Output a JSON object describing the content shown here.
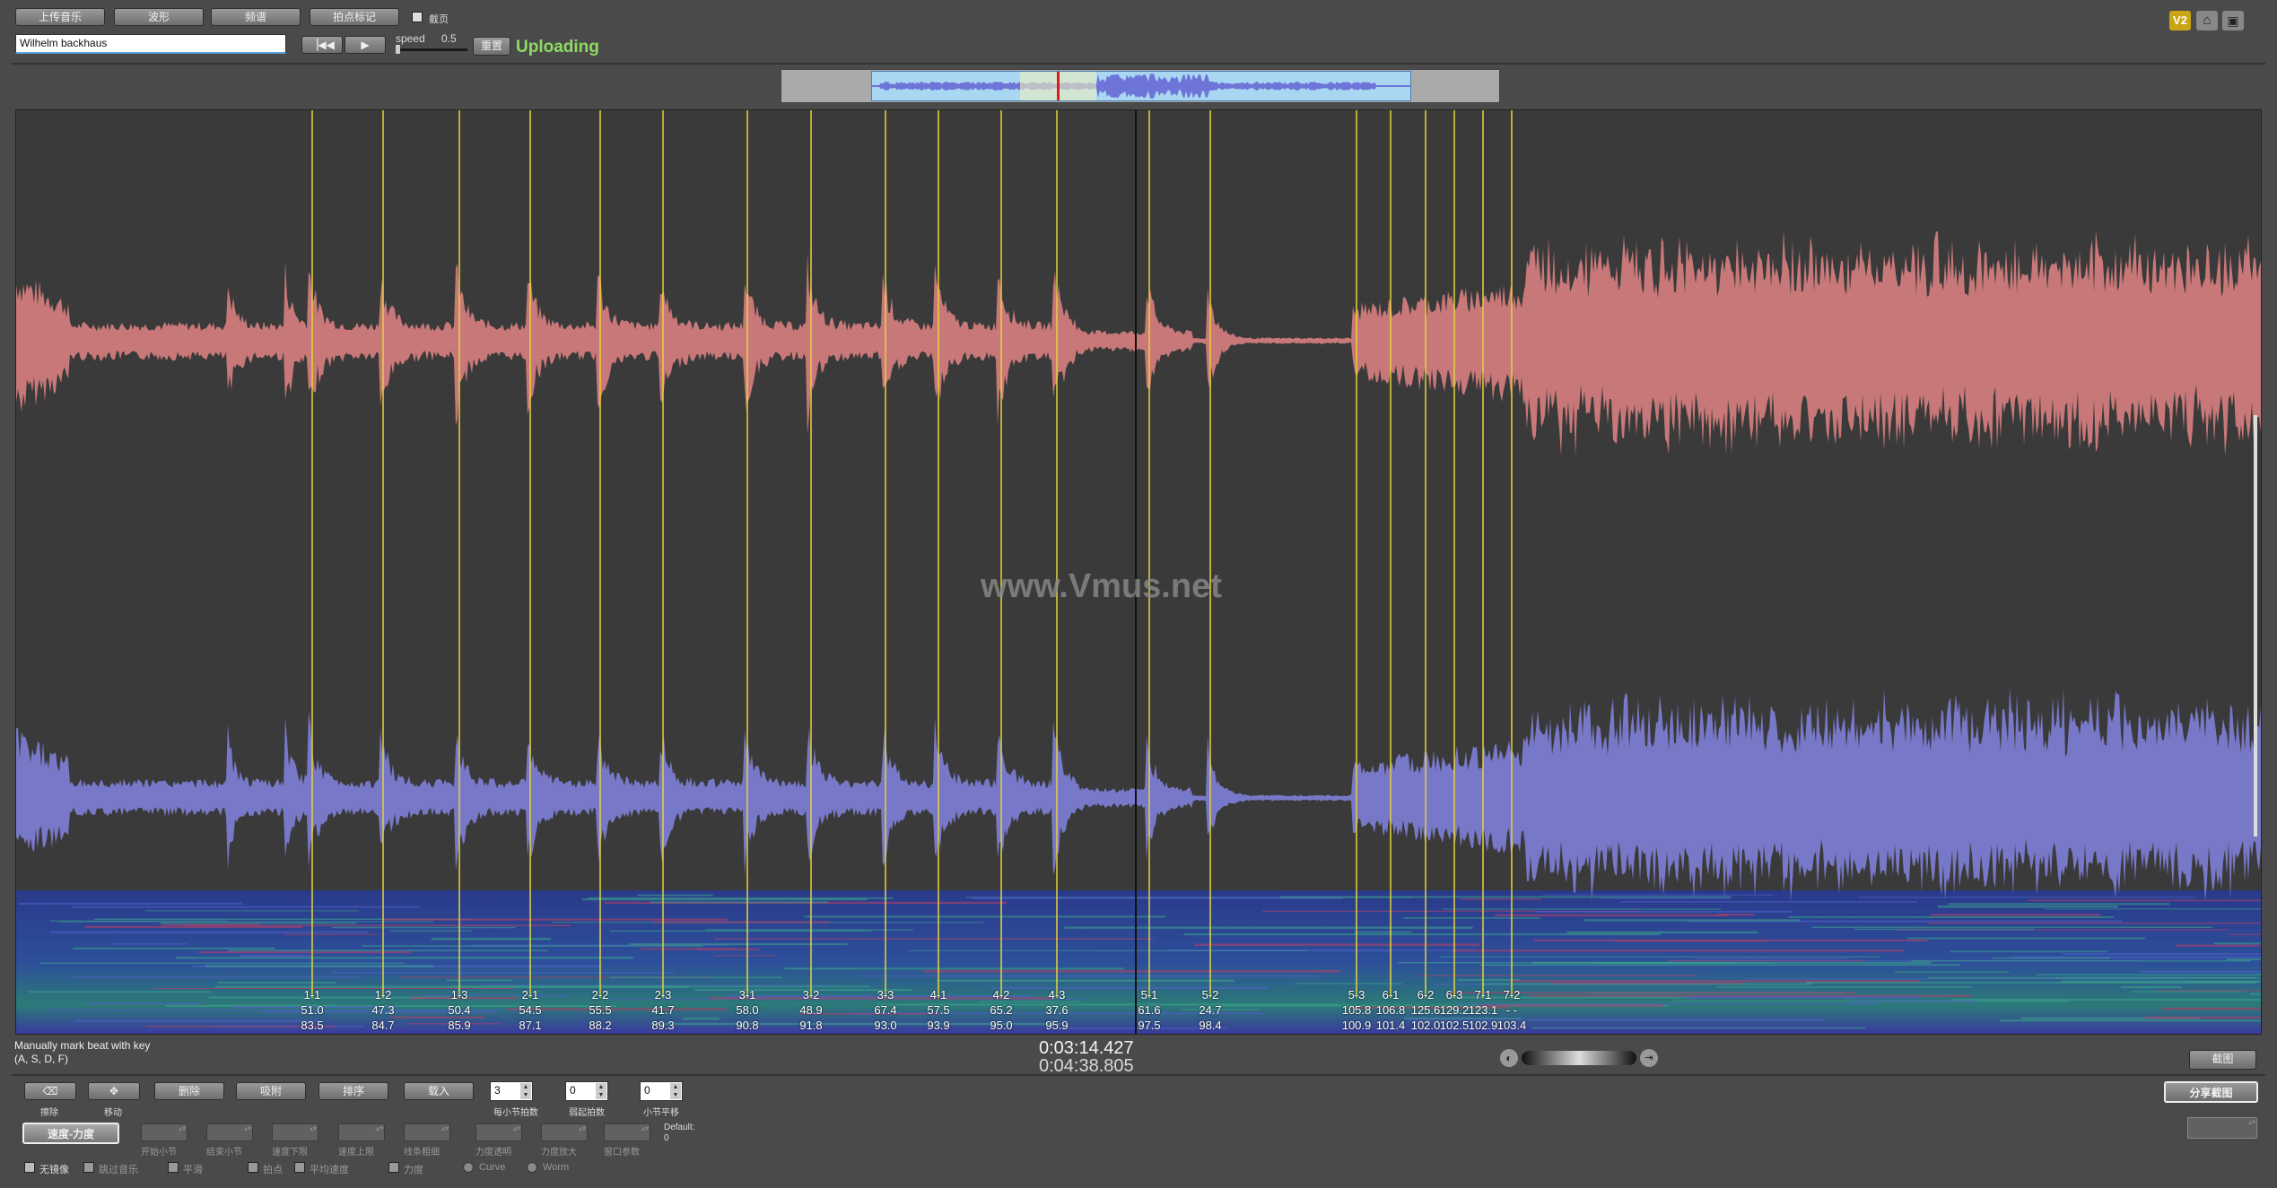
{
  "toolbar": {
    "buttons": [
      "上传音乐",
      "波形",
      "频谱",
      "拍点标记"
    ],
    "checkbox_label": "截页",
    "artist_input": "Wilhelm backhaus",
    "speed_label": "speed",
    "speed_value": "0.5",
    "reset_label": "重置",
    "status": "Uploading",
    "version_badge": "V2"
  },
  "overview": {
    "label": "overview-waveform"
  },
  "watermark": "www.Vmus.net",
  "beats": [
    {
      "label": "1-1",
      "tempo": "51.0",
      "time": "83.5"
    },
    {
      "label": "1-2",
      "tempo": "47.3",
      "time": "84.7"
    },
    {
      "label": "1-3",
      "tempo": "50.4",
      "time": "85.9"
    },
    {
      "label": "2-1",
      "tempo": "54.5",
      "time": "87.1"
    },
    {
      "label": "2-2",
      "tempo": "55.5",
      "time": "88.2"
    },
    {
      "label": "2-3",
      "tempo": "41.7",
      "time": "89.3"
    },
    {
      "label": "3-1",
      "tempo": "58.0",
      "time": "90.8"
    },
    {
      "label": "3-2",
      "tempo": "48.9",
      "time": "91.8"
    },
    {
      "label": "3-3",
      "tempo": "67.4",
      "time": "93.0"
    },
    {
      "label": "4-1",
      "tempo": "57.5",
      "time": "93.9"
    },
    {
      "label": "4-2",
      "tempo": "65.2",
      "time": "95.0"
    },
    {
      "label": "4-3",
      "tempo": "37.6",
      "time": "95.9"
    },
    {
      "label": "5-1",
      "tempo": "61.6",
      "time": "97.5"
    },
    {
      "label": "5-2",
      "tempo": "24.7",
      "time": "98.4"
    },
    {
      "label": "5-3",
      "tempo": "105.8",
      "time": "100.9"
    },
    {
      "label": "6-1",
      "tempo": "106.8",
      "time": "101.4"
    },
    {
      "label": "6-2",
      "tempo": "125.6",
      "time": "102.0"
    },
    {
      "label": "6-3",
      "tempo": "129.2",
      "time": "102.5"
    },
    {
      "label": "7-1",
      "tempo": "123.1",
      "time": "102.9"
    },
    {
      "label": "7-2",
      "tempo": "- -",
      "time": "103.4"
    }
  ],
  "hint_line1": "Manually mark beat with key",
  "hint_line2": "(A, S, D, F)",
  "time_current": "0:03:14.427",
  "time_total": "0:04:38.805",
  "right_buttons": {
    "screenshot": "截图",
    "share": "分享截图"
  },
  "bottom": {
    "row1_buttons": [
      "擦除",
      "",
      "删除",
      "吸附",
      "排序",
      "载入"
    ],
    "row1_sub": [
      "擦除",
      "移动"
    ],
    "spin1": {
      "value": "3",
      "label": "每小节拍数"
    },
    "spin2": {
      "value": "0",
      "label": "弱起拍数"
    },
    "spin3": {
      "value": "0",
      "label": "小节平移"
    },
    "mode_button": "速度-力度",
    "row2_labels": [
      "开始小节",
      "结束小节",
      "速度下限",
      "速度上限",
      "线条粗细",
      "力度透明",
      "力度放大",
      "窗口参数"
    ],
    "default_label": "Default:",
    "default_value": "0",
    "checks": [
      "无镜像",
      "跳过音乐",
      "平滑",
      "拍点",
      "平均速度",
      "力度"
    ],
    "radios": [
      "Curve",
      "Worm"
    ]
  }
}
